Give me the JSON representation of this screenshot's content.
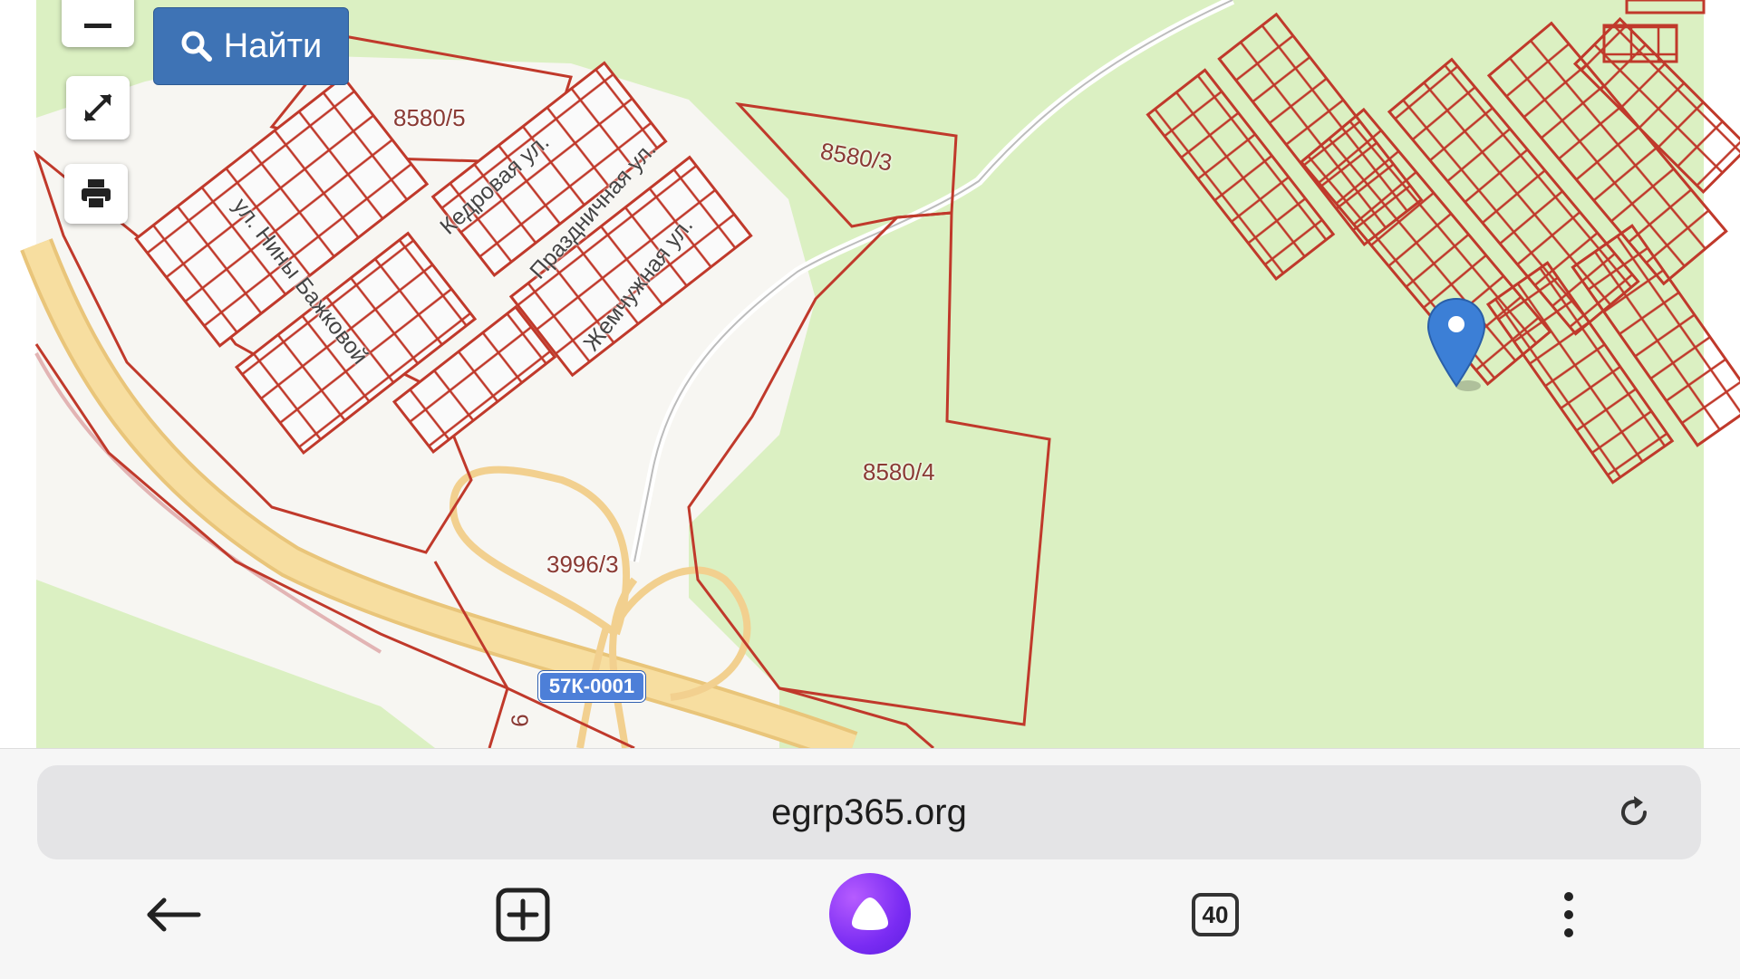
{
  "map": {
    "find_button_label": "Найти",
    "zoom_out_label": "−",
    "parcel_labels": [
      "8580/5",
      "8580/3",
      "8580/4",
      "3996/3"
    ],
    "street_labels": [
      "ул. Нины Бажковой",
      "Кедровая ул.",
      "Праздничная ул.",
      "Жемчужная ул."
    ],
    "road_shield": "57К-0001",
    "road_side_label": "9",
    "colors": {
      "forest": "#dbf0c2",
      "parcel_border": "#c0392b",
      "highway": "#f5d58e",
      "find_button": "#3e73b5",
      "marker": "#3c7fd6"
    }
  },
  "browser": {
    "url": "egrp365.org",
    "tabs_count": "40",
    "icons": [
      "back-arrow-icon",
      "new-tab-icon",
      "alice-icon",
      "tabs-icon",
      "more-icon",
      "reload-icon"
    ]
  }
}
